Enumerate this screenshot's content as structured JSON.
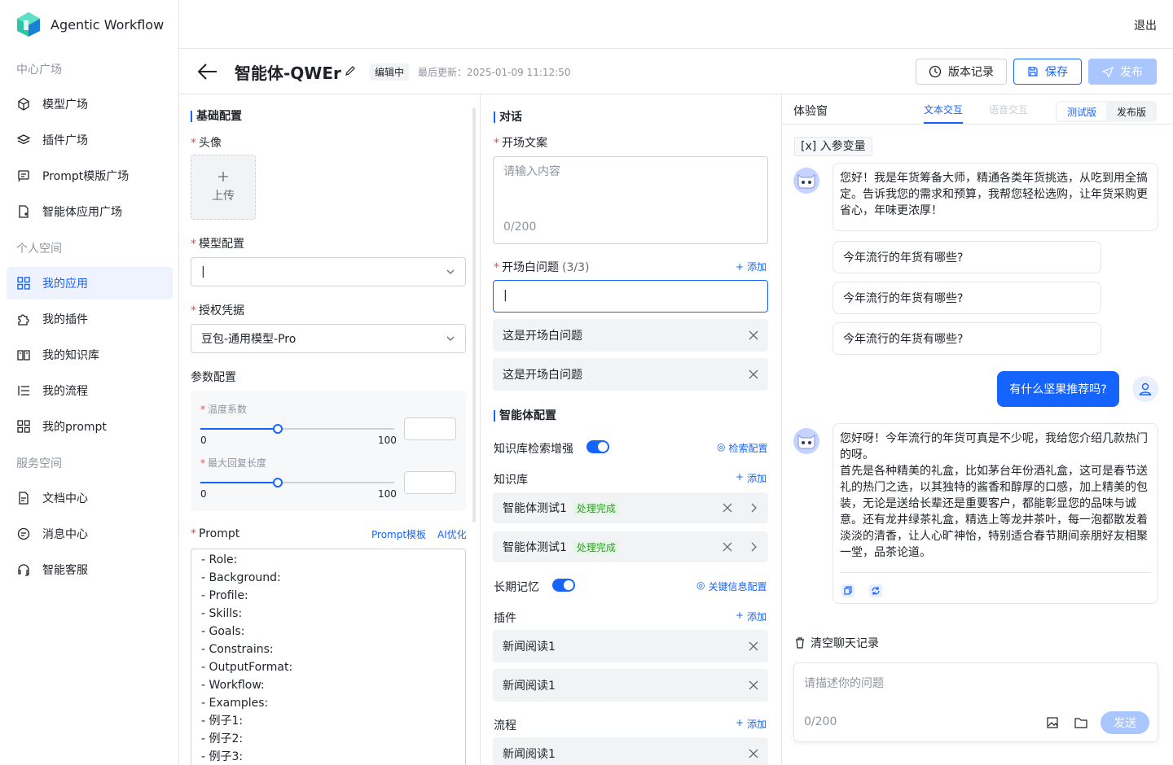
{
  "app": {
    "name": "Agentic Workflow",
    "logout": "退出"
  },
  "sidebar": {
    "sections": [
      "中心广场",
      "个人空间",
      "服务空间"
    ],
    "items": [
      {
        "label": "模型广场",
        "icon": "cube-icon"
      },
      {
        "label": "插件广场",
        "icon": "layers-icon"
      },
      {
        "label": "Prompt模版广场",
        "icon": "prompt-icon"
      },
      {
        "label": "智能体应用广场",
        "icon": "agent-app-icon"
      },
      {
        "label": "我的应用",
        "icon": "grid-icon",
        "active": true
      },
      {
        "label": "我的插件",
        "icon": "puzzle-icon"
      },
      {
        "label": "我的知识库",
        "icon": "book-icon"
      },
      {
        "label": "我的流程",
        "icon": "list-icon"
      },
      {
        "label": "我的prompt",
        "icon": "grid-icon"
      },
      {
        "label": "文档中心",
        "icon": "document-icon"
      },
      {
        "label": "消息中心",
        "icon": "message-icon"
      },
      {
        "label": "智能客服",
        "icon": "headset-icon"
      }
    ]
  },
  "header": {
    "title": "智能体-QWEr",
    "status": "编辑中",
    "updated": "最后更新：2025-01-09 11:12:50",
    "version_btn": "版本记录",
    "save_btn": "保存",
    "publish_btn": "发布"
  },
  "basic": {
    "section": "基础配置",
    "avatar_label": "头像",
    "upload_label": "上传",
    "model_label": "模型配置",
    "model_value": "|",
    "auth_label": "授权凭据",
    "auth_value": "豆包-通用模型-Pro",
    "param_label": "参数配置",
    "temp_label": "温度系数",
    "temp_min": "0",
    "temp_max": "100",
    "temp_value": 0.4,
    "maxlen_label": "最大回复长度",
    "maxlen_min": "0",
    "maxlen_max": "100",
    "maxlen_value": 0.4,
    "prompt_label": "Prompt",
    "prompt_template": "Prompt模板",
    "ai_optimize": "AI优化",
    "prompt_lines": [
      "- Role:",
      "- Background:",
      "- Profile:",
      "- Skills:",
      "- Goals:",
      "- Constrains:",
      "- OutputFormat:",
      "- Workflow:",
      "- Examples:",
      "- 例子1:",
      "- 例子2:",
      "- 例子3:"
    ]
  },
  "dialog": {
    "section": "对话",
    "opening_label": "开场文案",
    "opening_placeholder": "请输入内容",
    "opening_count": "0/200",
    "questions_label": "开场白问题",
    "questions_count": "(3/3)",
    "add": "添加",
    "question_input": "|",
    "questions": [
      "这是开场白问题",
      "这是开场白问题"
    ]
  },
  "agent": {
    "section": "智能体配置",
    "kb_enhance_label": "知识库检索增强",
    "kb_enhance_on": true,
    "retrieval_config": "检索配置",
    "kb_label": "知识库",
    "kb_items": [
      {
        "name": "智能体测试1",
        "status": "处理完成"
      },
      {
        "name": "智能体测试1",
        "status": "处理完成"
      }
    ],
    "memory_label": "长期记忆",
    "memory_on": true,
    "memory_config": "关键信息配置",
    "plugin_label": "插件",
    "plugin_items": [
      "新闻阅读1",
      "新闻阅读1"
    ],
    "flow_label": "流程",
    "flow_items": [
      "新闻阅读1"
    ]
  },
  "chat": {
    "title": "体验窗",
    "tab_text": "文本交互",
    "tab_voice": "语音交互",
    "seg_test": "测试版",
    "seg_release": "发布版",
    "var_btn": "[x]  入参变量",
    "welcome": "您好！我是年货筹备大师，精通各类年货挑选，从吃到用全搞定。告诉我您的需求和预算，我帮您轻松选购，让年货采购更省心，年味更浓厚！",
    "suggestions": [
      "今年流行的年货有哪些?",
      "今年流行的年货有哪些?",
      "今年流行的年货有哪些?"
    ],
    "user_msg": "有什么坚果推荐吗?",
    "reply_p1": "您好呀！今年流行的年货可真是不少呢，我给您介绍几款热门的呀。",
    "reply_p2": "首先是各种精美的礼盒，比如茅台年份酒礼盒，这可是春节送礼的热门之选，以其独特的酱香和醇厚的口感，加上精美的包装，无论是送给长辈还是重要客户，都能彰显您的品味与诚意。还有龙井绿茶礼盒，精选上等龙井茶叶，每一泡都散发着淡淡的清香，让人心旷神怡，特别适合春节期间亲朋好友相聚一堂，品茶论道。",
    "clear": "清空聊天记录",
    "input_placeholder": "请描述你的问题",
    "input_count": "0/200",
    "send": "发送"
  },
  "colors": {
    "primary": "#1664ff",
    "required": "#f54a45",
    "success": "#2ea121"
  }
}
